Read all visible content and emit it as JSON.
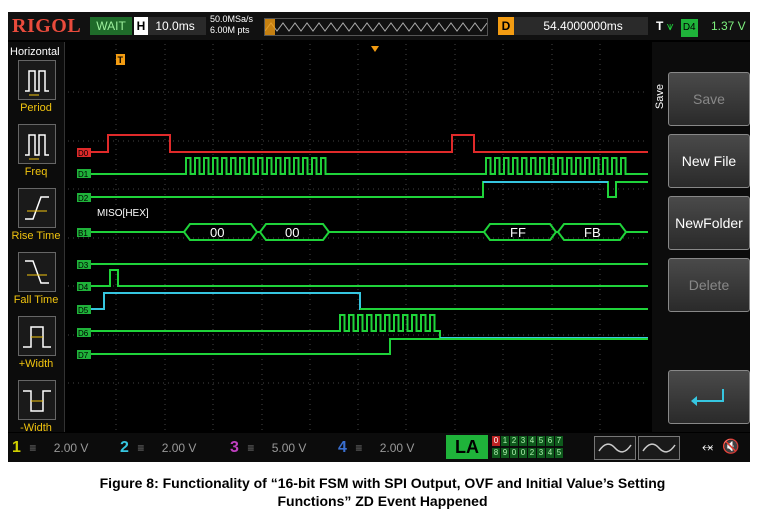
{
  "header": {
    "brand": "RIGOL",
    "status": "WAIT",
    "h_label": "H",
    "timebase": "10.0ms",
    "sample_rate": "50.0MSa/s",
    "mem_depth": "6.00M pts",
    "d_label": "D",
    "delay": "54.4000000ms",
    "trigger_label": "T",
    "trigger_source": "D4",
    "trigger_level": "1.37 V"
  },
  "left_panel": {
    "title": "Horizontal",
    "items": [
      {
        "label": "Period"
      },
      {
        "label": "Freq"
      },
      {
        "label": "Rise Time"
      },
      {
        "label": "Fall Time"
      },
      {
        "label": "+Width"
      },
      {
        "label": "-Width"
      }
    ]
  },
  "right_panel": {
    "title": "Save",
    "buttons": [
      {
        "label": "Save",
        "enabled": false
      },
      {
        "label": "New File",
        "enabled": true
      },
      {
        "label": "NewFolder",
        "enabled": true
      },
      {
        "label": "Delete",
        "enabled": false
      },
      {
        "label": "",
        "enabled": true
      }
    ]
  },
  "channels": {
    "d0": "D0",
    "d1": "D1",
    "d2": "D2",
    "b1": "B1",
    "d3": "D3",
    "d4": "D4",
    "d5": "D5",
    "d6": "D6",
    "d7": "D7",
    "bus_label": "MISO[HEX]",
    "bus_values": [
      "00",
      "00",
      "FF",
      "FB"
    ],
    "trigger_marker": "T"
  },
  "bottom": {
    "ch1": {
      "num": "1",
      "volt": "2.00 V"
    },
    "ch2": {
      "num": "2",
      "volt": "2.00 V"
    },
    "ch3": {
      "num": "3",
      "volt": "5.00 V"
    },
    "ch4": {
      "num": "4",
      "volt": "2.00 V"
    },
    "la": "LA",
    "la_top": [
      "0",
      "1",
      "2",
      "3",
      "4",
      "5",
      "6",
      "7"
    ],
    "la_bottom": [
      "8",
      "9",
      "0",
      "0",
      "2",
      "3",
      "4",
      "5"
    ]
  },
  "caption": {
    "line1": "Figure 8: Functionality of “16-bit FSM with SPI Output, OVF and Initial Value’s Setting",
    "line2": "Functions” ZD Event Happened"
  },
  "colors": {
    "d0": "#e02a2a",
    "green": "#1fd33a",
    "cyan": "#36c6e0",
    "trigger": "#f39c12"
  }
}
